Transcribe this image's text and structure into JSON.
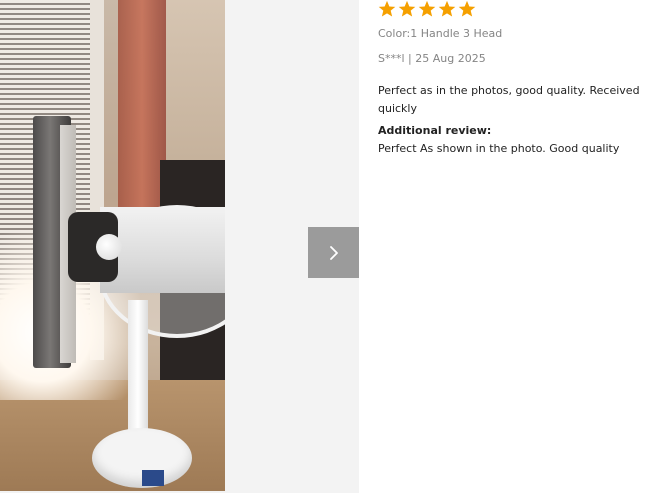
{
  "gallery": {
    "next_icon": "chevron-right-icon",
    "next_button_color": "#9b9b9b"
  },
  "review": {
    "rating": 5,
    "star_icon": "star-icon",
    "star_color": "#f5a000",
    "color_option": "Color:1 Handle 3 Head",
    "author_date": "S***l | 25 Aug 2025",
    "text": "Perfect as in the photos, good quality. Received quickly",
    "additional_title": "Additional review:",
    "additional_text": "Perfect As shown in the photo. Good quality"
  }
}
